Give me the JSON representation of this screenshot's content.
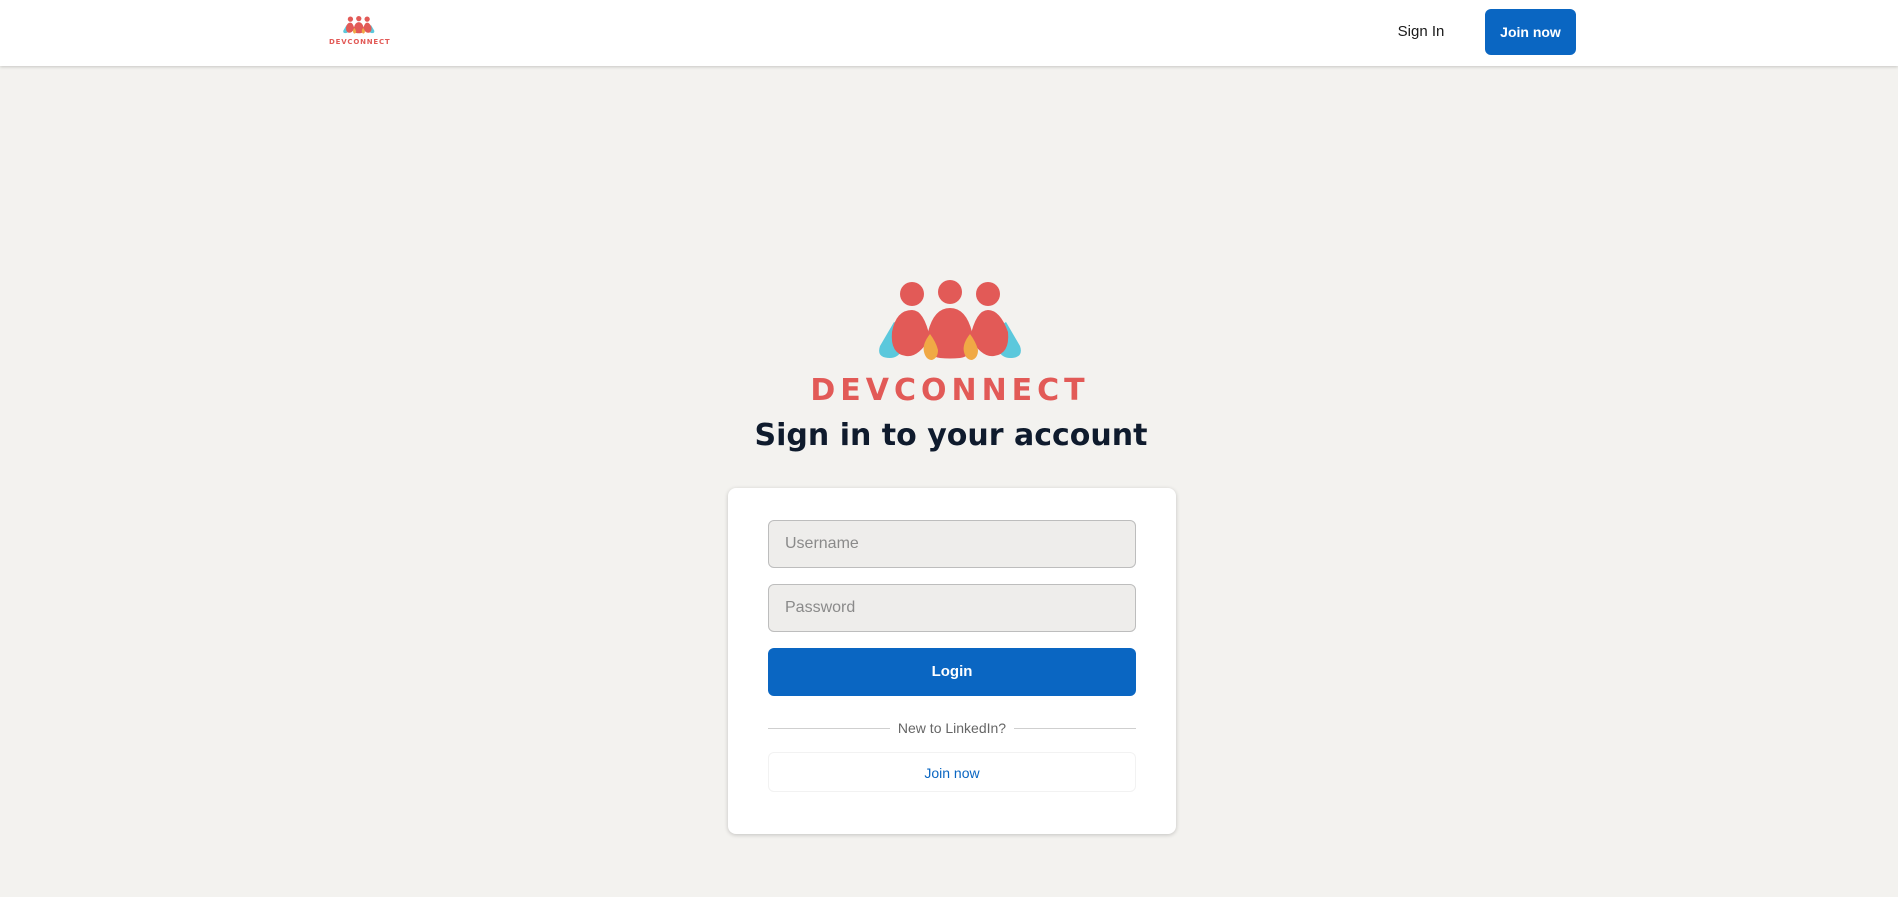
{
  "brand": {
    "name": "DEVCONNECT",
    "colors": {
      "red": "#e25a57",
      "teal": "#5bc8dc",
      "gold": "#f0a945"
    }
  },
  "nav": {
    "signin_label": "Sign In",
    "join_label": "Join now"
  },
  "page": {
    "title": "Sign in to your account"
  },
  "form": {
    "username_placeholder": "Username",
    "username_value": "",
    "password_placeholder": "Password",
    "password_value": "",
    "login_label": "Login",
    "divider_text": "New to LinkedIn?",
    "join_label": "Join now"
  },
  "theme": {
    "accent": "#0a66c2",
    "background": "#f3f2ef",
    "card": "#ffffff",
    "title_color": "#0f1b2d"
  }
}
